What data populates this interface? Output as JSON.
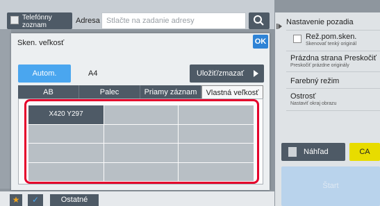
{
  "topbar": {
    "address_book_label": "Telefónny zoznam",
    "address_label": "Adresa",
    "address_placeholder": "Stlačte na zadanie adresy"
  },
  "right_panel": {
    "items": [
      {
        "title": "Nastavenie pozadia",
        "sub": ""
      },
      {
        "title": "Rež.pom.sken.",
        "sub": "Skenovať tenký originál"
      },
      {
        "title": "Prázdna strana Preskočiť",
        "sub": "Preskočiť prázdne originály"
      },
      {
        "title": "Farebný režim",
        "sub": ""
      },
      {
        "title": "Ostrosť",
        "sub": "Nastaviť okraj obrazu"
      }
    ],
    "preview_label": "Náhľad",
    "ca_label": "CA",
    "start_label": "Štart"
  },
  "dialog": {
    "title": "Sken. veľkosť",
    "ok_label": "OK",
    "auto_label": "Autom.",
    "auto_value": "A4",
    "store_label": "Uložiť/zmazať",
    "tabs": [
      "AB",
      "Palec",
      "Priamy záznam",
      "Vlastná veľkosť"
    ],
    "active_tab": "Vlastná veľkosť",
    "custom_sizes": [
      "X420 Y297",
      "",
      "",
      "",
      "",
      "",
      "",
      "",
      "",
      "",
      "",
      ""
    ]
  },
  "bottom": {
    "other_label": "Ostatné"
  },
  "colors": {
    "accent_blue": "#4aa6ef",
    "dark_button": "#4e5a66",
    "highlight_frame": "#e5002b",
    "ca_yellow": "#e8dc00"
  }
}
